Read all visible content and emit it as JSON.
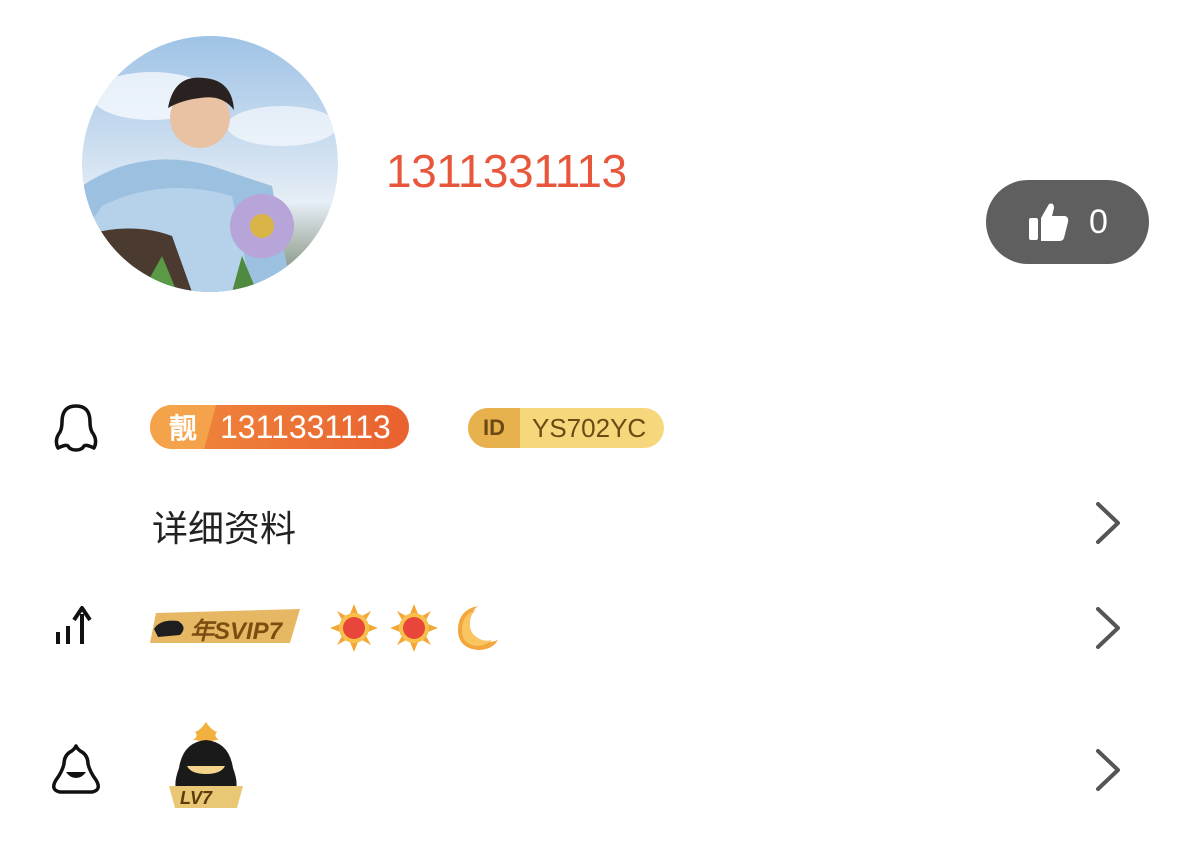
{
  "profile": {
    "username": "1311331113",
    "avatar_icon": "avatar-photo"
  },
  "like": {
    "icon": "thumbs-up-icon",
    "count": "0"
  },
  "rows": {
    "account": {
      "icon": "qq-penguin-icon",
      "liang_char": "靓",
      "number": "1311331113",
      "id_mark": "ID",
      "id_value": "YS702YC"
    },
    "details": {
      "label": "详细资料",
      "chevron": "chevron-right-icon"
    },
    "vip": {
      "icon": "level-up-icon",
      "svip_label": "年SVIP7",
      "level_icons": [
        "sun-icon",
        "sun-icon",
        "moon-icon"
      ],
      "chevron": "chevron-right-icon"
    },
    "lv": {
      "icon": "penguin-outline-icon",
      "level_label": "LV7",
      "chevron": "chevron-right-icon"
    }
  },
  "colors": {
    "username": "#e8563b",
    "like_pill": "#5f5f5f",
    "liang_badge": "#e9612f",
    "id_badge": "#f6d77c",
    "svip_gold": "#e3b25a"
  }
}
